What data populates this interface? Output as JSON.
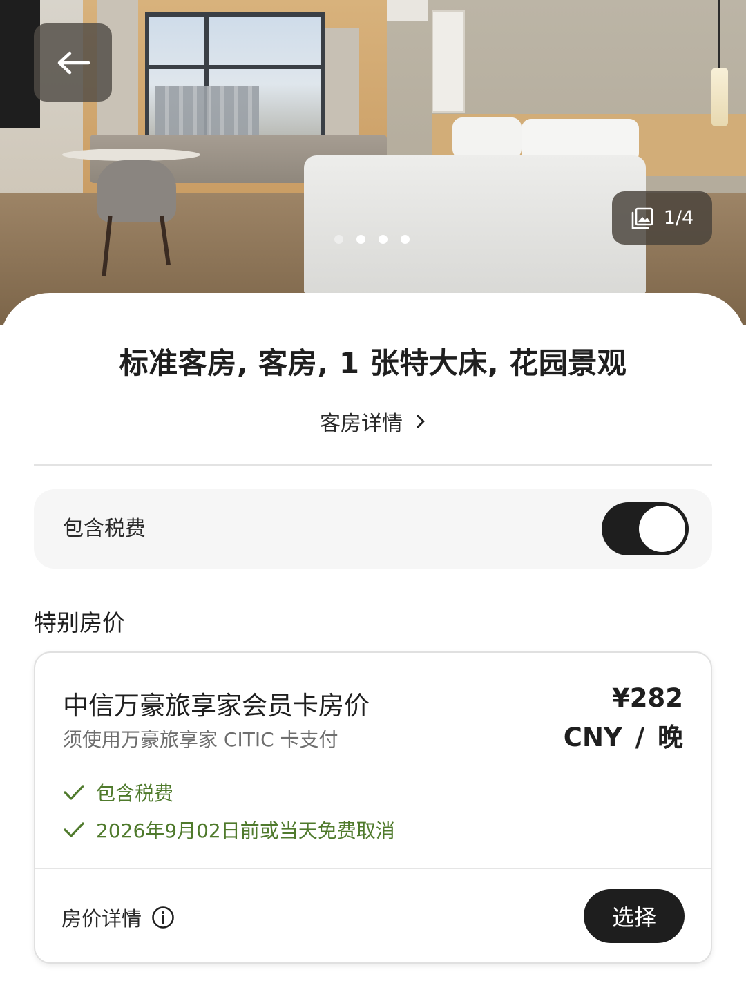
{
  "hero": {
    "photo_counter": "1/4",
    "slide_count": 4,
    "active_slide": 1
  },
  "room": {
    "title": "标准客房, 客房, 1 张特大床, 花园景观",
    "details_link": "客房详情"
  },
  "tax_toggle": {
    "label": "包含税费",
    "on": true
  },
  "special_rates": {
    "section_title": "特别房价",
    "rate": {
      "name": "中信万豪旅享家会员卡房价",
      "subtitle": "须使用万豪旅享家 CITIC 卡支付",
      "price": "¥282",
      "price_unit": "CNY / 晚",
      "perks": [
        "包含税费",
        "2026年9月02日前或当天免费取消"
      ],
      "details_link": "房价详情",
      "select_button": "选择"
    }
  },
  "colors": {
    "accent_dark": "#1e1e1e",
    "perk_green": "#4f7a2c",
    "subtle_gray": "#6e6e6e"
  },
  "icons": [
    "back-arrow-icon",
    "gallery-icon",
    "chevron-right-icon",
    "check-icon",
    "info-icon"
  ]
}
